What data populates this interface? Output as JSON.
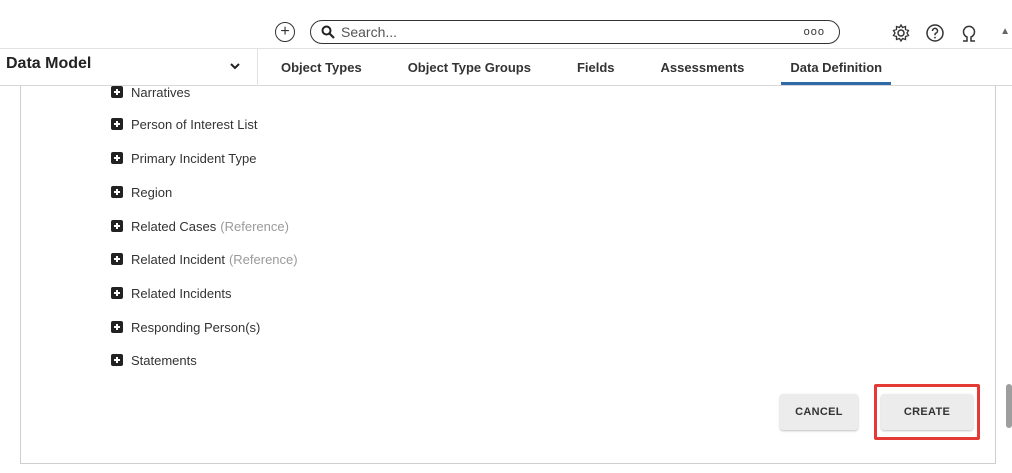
{
  "topbar": {
    "search_placeholder": "Search...",
    "search_more": "ooo",
    "icons": [
      "add-icon",
      "search-icon",
      "more-icon",
      "gear-icon",
      "help-icon",
      "user-icon"
    ]
  },
  "module": {
    "title": "Data Model"
  },
  "tabs": [
    {
      "label": "Object Types",
      "active": false
    },
    {
      "label": "Object Type Groups",
      "active": false
    },
    {
      "label": "Fields",
      "active": false
    },
    {
      "label": "Assessments",
      "active": false
    },
    {
      "label": "Data Definition",
      "active": true
    }
  ],
  "items": [
    {
      "label": "Narratives",
      "ref": ""
    },
    {
      "label": "Person of Interest List",
      "ref": ""
    },
    {
      "label": "Primary Incident Type",
      "ref": ""
    },
    {
      "label": "Region",
      "ref": ""
    },
    {
      "label": "Related Cases",
      "ref": "(Reference)"
    },
    {
      "label": "Related Incident",
      "ref": "(Reference)"
    },
    {
      "label": "Related Incidents",
      "ref": ""
    },
    {
      "label": "Responding Person(s)",
      "ref": ""
    },
    {
      "label": "Statements",
      "ref": ""
    }
  ],
  "buttons": {
    "cancel": "CANCEL",
    "create": "CREATE"
  },
  "colors": {
    "accent": "#2f6ba8",
    "highlight": "#e53935"
  }
}
